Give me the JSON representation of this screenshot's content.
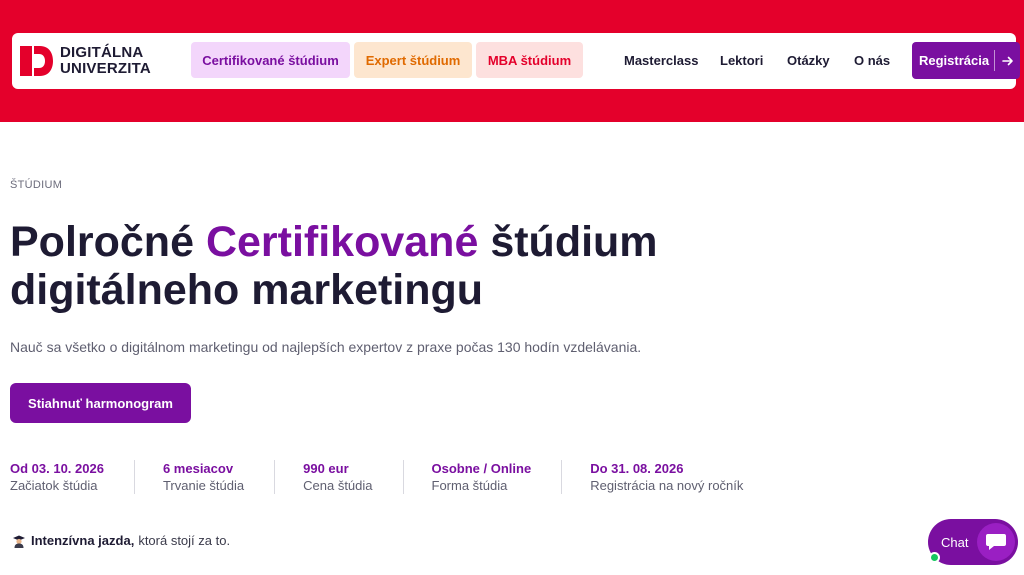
{
  "brand": {
    "line1": "DIGITÁLNA",
    "line2": "UNIVERZITA",
    "logo_icon": "du-logo-mark",
    "color": "#e4002b"
  },
  "nav": {
    "pills": [
      {
        "label": "Certifikované štúdium"
      },
      {
        "label": "Expert štúdium"
      },
      {
        "label": "MBA štúdium"
      }
    ],
    "links": [
      "Masterclass",
      "Lektori",
      "Otázky",
      "O nás"
    ],
    "register_label": "Registrácia",
    "register_icon": "arrow-right-icon"
  },
  "hero": {
    "eyebrow": "ŠTÚDIUM",
    "title_part1": "Polročné ",
    "title_accent": "Certifikované",
    "title_part2": " štúdium digitálneho marketingu",
    "lead": "Nauč sa všetko o digitálnom marketingu od najlepších expertov z praxe počas 130 hodín vzdelávania.",
    "cta_label": "Stiahnuť harmonogram"
  },
  "facts": [
    {
      "value": "Od 03. 10. 2026",
      "label": "Začiatok štúdia"
    },
    {
      "value": "6 mesiacov",
      "label": "Trvanie štúdia"
    },
    {
      "value": "990 eur",
      "label": "Cena štúdia"
    },
    {
      "value": "Osobne / Online",
      "label": "Forma štúdia"
    },
    {
      "value": "Do 31. 08. 2026",
      "label": "Registrácia na nový ročník"
    }
  ],
  "note": {
    "icon": "graduate-icon",
    "bold": "Intenzívna jazda,",
    "rest": "ktorá stojí za to."
  },
  "chat": {
    "label": "Chat",
    "icon": "chat-bubble-icon",
    "status_color": "#16c85f"
  },
  "colors": {
    "accent": "#7a0fa0",
    "brand_red": "#e4002b",
    "text": "#1e1b33"
  }
}
